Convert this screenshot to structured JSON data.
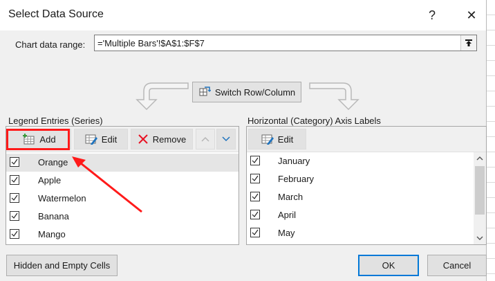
{
  "window": {
    "title": "Select Data Source",
    "help_label": "?",
    "close_label": "✕"
  },
  "range": {
    "label": "Chart data range:",
    "value": "='Multiple Bars'!$A$1:$F$7"
  },
  "switch_button": {
    "label": "Switch Row/Column"
  },
  "legend": {
    "title": "Legend Entries (Series)",
    "add_label": "Add",
    "edit_label": "Edit",
    "remove_label": "Remove",
    "items": [
      {
        "label": "Orange",
        "checked": true,
        "selected": true
      },
      {
        "label": "Apple",
        "checked": true
      },
      {
        "label": "Watermelon",
        "checked": true
      },
      {
        "label": "Banana",
        "checked": true
      },
      {
        "label": "Mango",
        "checked": true
      }
    ]
  },
  "axis": {
    "title": "Horizontal (Category) Axis Labels",
    "edit_label": "Edit",
    "items": [
      {
        "label": "January",
        "checked": true
      },
      {
        "label": "February",
        "checked": true
      },
      {
        "label": "March",
        "checked": true
      },
      {
        "label": "April",
        "checked": true
      },
      {
        "label": "May",
        "checked": true
      }
    ]
  },
  "footer": {
    "hidden_label": "Hidden and Empty Cells",
    "ok_label": "OK",
    "cancel_label": "Cancel"
  },
  "colors": {
    "annotation_red": "#ff1a1a",
    "ok_border": "#0078d7",
    "remove_icon": "#e81123",
    "edit_icon_blue": "#1e73be",
    "add_icon_green": "#3a9a3a"
  }
}
